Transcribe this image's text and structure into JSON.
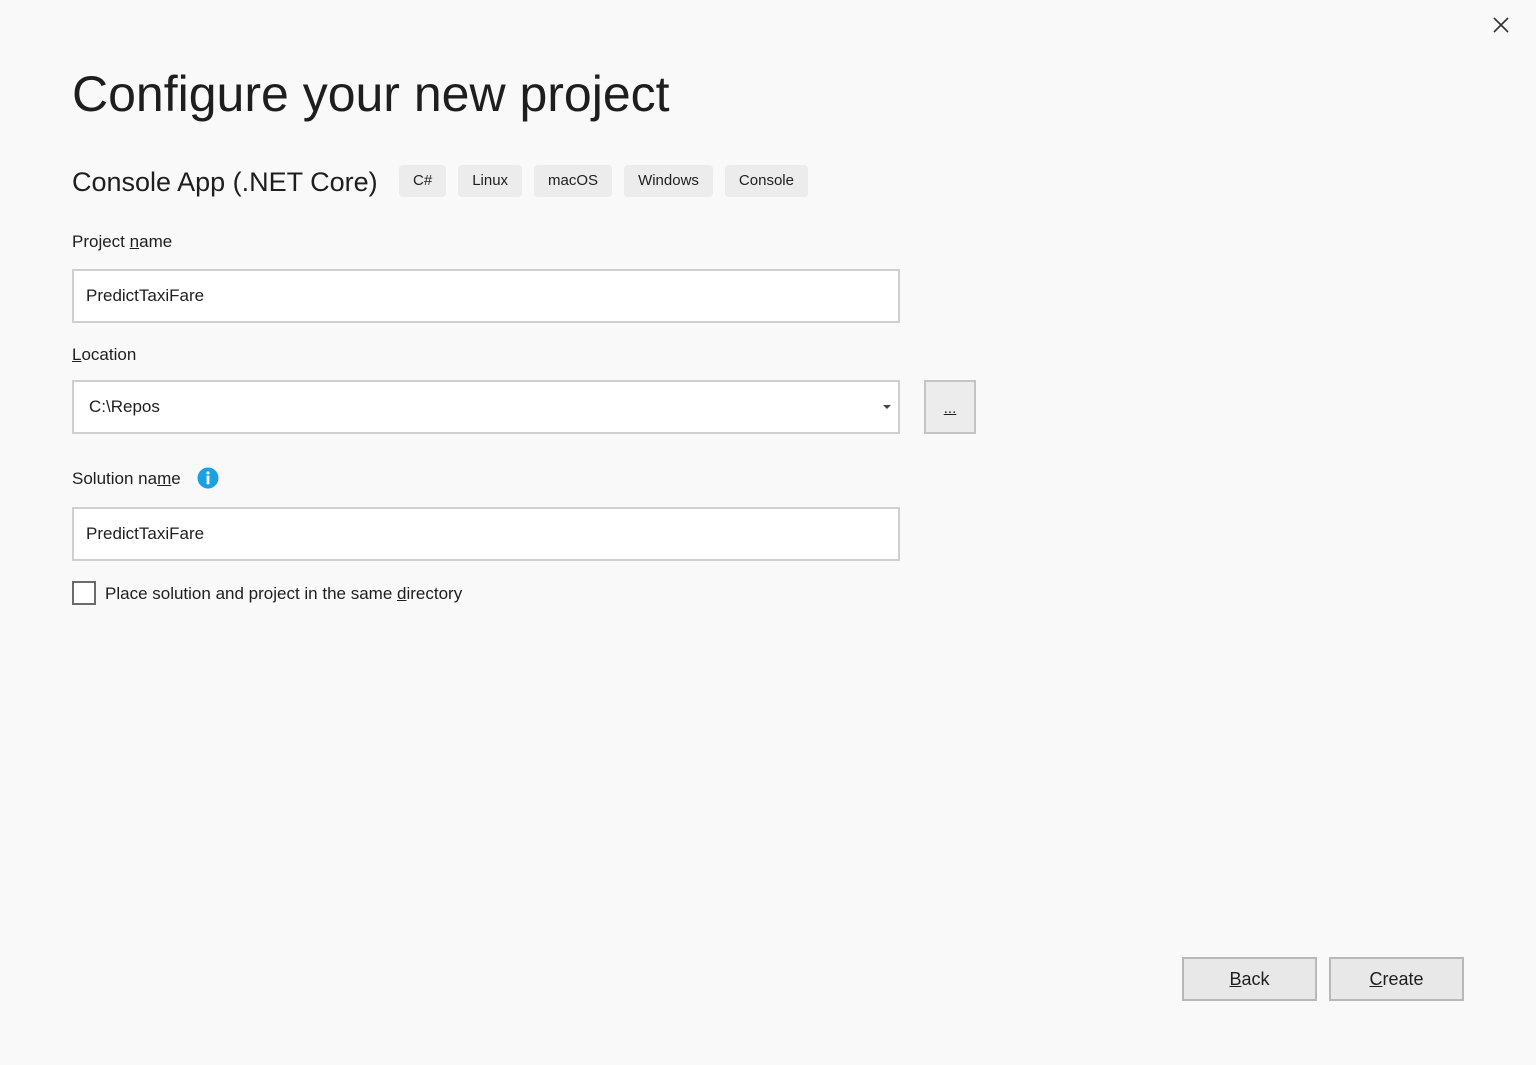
{
  "dialog": {
    "title": "Configure your new project",
    "close_icon": "close-icon"
  },
  "template": {
    "name": "Console App (.NET Core)",
    "tags": [
      "C#",
      "Linux",
      "macOS",
      "Windows",
      "Console"
    ]
  },
  "project_name": {
    "label_before": "Project ",
    "label_accel": "n",
    "label_after": "ame",
    "value": "PredictTaxiFare"
  },
  "location": {
    "label_accel": "L",
    "label_after": "ocation",
    "value": "C:\\Repos",
    "dropdown_icon": "chevron-down-icon",
    "browse_label": "..."
  },
  "solution_name": {
    "label_before": "Solution na",
    "label_accel": "m",
    "label_after": "e",
    "value": "PredictTaxiFare",
    "info_icon": "info-icon",
    "info_color": "#1ba1e2"
  },
  "same_directory": {
    "label_before": "Place solution and project in the same ",
    "label_accel": "d",
    "label_after": "irectory",
    "checked": false
  },
  "footer": {
    "back_accel": "B",
    "back_rest": "ack",
    "create_accel": "C",
    "create_rest": "reate"
  }
}
